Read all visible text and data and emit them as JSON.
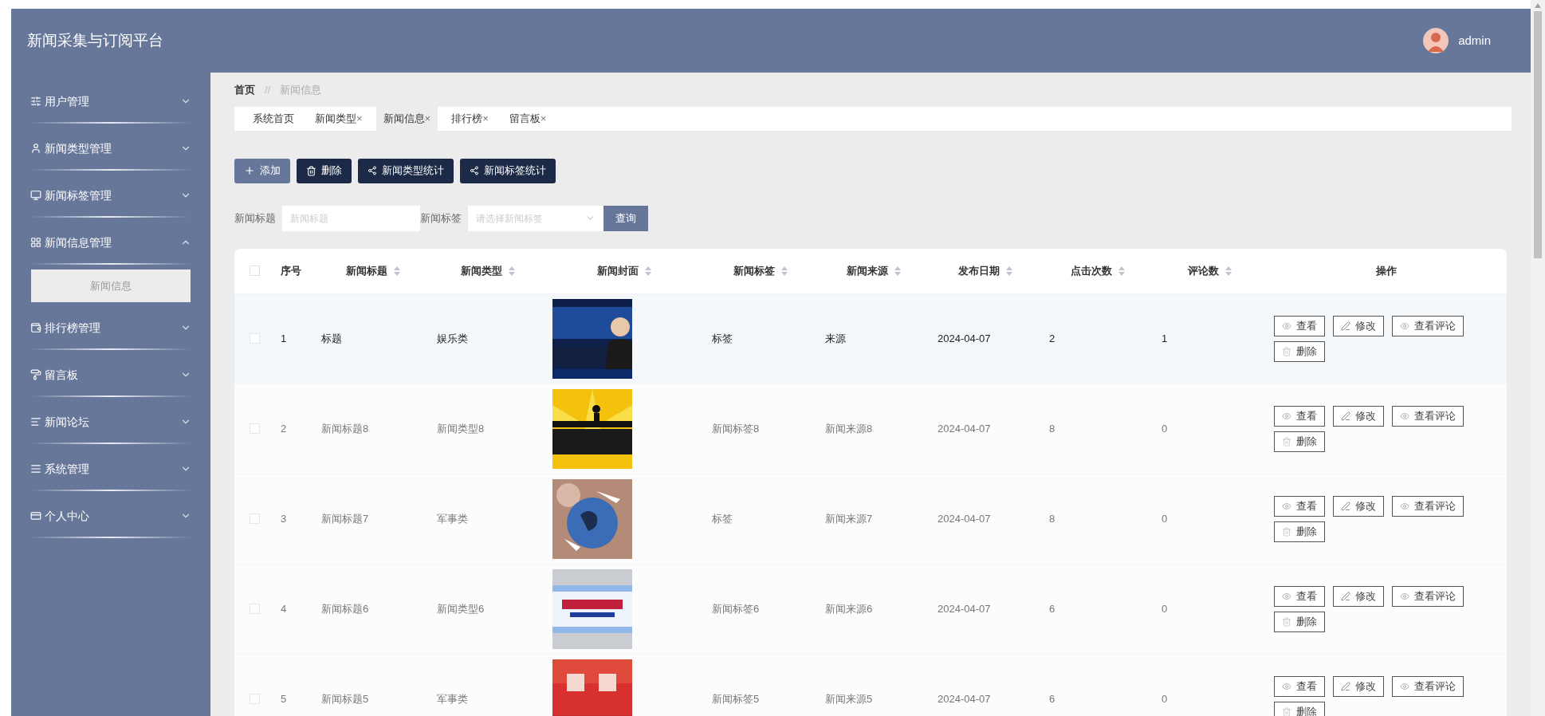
{
  "header": {
    "title": "新闻采集与订阅平台",
    "user": "admin"
  },
  "sidebar": {
    "items": [
      {
        "label": "用户管理",
        "expanded": false
      },
      {
        "label": "新闻类型管理",
        "expanded": false
      },
      {
        "label": "新闻标签管理",
        "expanded": false
      },
      {
        "label": "新闻信息管理",
        "expanded": true,
        "children": [
          {
            "label": "新闻信息",
            "selected": true
          }
        ]
      },
      {
        "label": "排行榜管理",
        "expanded": false
      },
      {
        "label": "留言板",
        "expanded": false
      },
      {
        "label": "新闻论坛",
        "expanded": false
      },
      {
        "label": "系统管理",
        "expanded": false
      },
      {
        "label": "个人中心",
        "expanded": false
      }
    ]
  },
  "breadcrumb": [
    {
      "label": "首页"
    },
    {
      "label": "新闻信息"
    }
  ],
  "breadcrumb_separator": "//",
  "tabs": [
    {
      "label": "系统首页",
      "selected": false
    },
    {
      "label": "新闻类型",
      "close": "×",
      "selected": false
    },
    {
      "label": "新闻信息",
      "close": "×",
      "selected": true
    },
    {
      "label": "排行榜",
      "close": "×",
      "selected": false
    },
    {
      "label": "留言板",
      "close": "×",
      "selected": false
    }
  ],
  "toolbar": [
    {
      "label": "添加",
      "kind": "add"
    },
    {
      "label": "删除",
      "kind": "delete"
    },
    {
      "label": "新闻类型统计",
      "kind": "stats"
    },
    {
      "label": "新闻标签统计",
      "kind": "stats"
    }
  ],
  "search": {
    "fields": [
      {
        "label": "新闻标题",
        "placeholder": "新闻标题",
        "kind": "text"
      },
      {
        "label": "新闻标签",
        "placeholder": "请选择新闻标签",
        "kind": "select"
      }
    ],
    "button": "查询"
  },
  "table": {
    "header_checked": false,
    "columns": [
      {
        "label": "序号",
        "sortable": false
      },
      {
        "label": "新闻标题",
        "sortable": true
      },
      {
        "label": "新闻类型",
        "sortable": true
      },
      {
        "label": "新闻封面",
        "sortable": true
      },
      {
        "label": "新闻标签",
        "sortable": true
      },
      {
        "label": "新闻来源",
        "sortable": true
      },
      {
        "label": "发布日期",
        "sortable": true
      },
      {
        "label": "点击次数",
        "sortable": true
      },
      {
        "label": "评论数",
        "sortable": true
      },
      {
        "label": "操作",
        "sortable": false
      }
    ],
    "rows": [
      {
        "checked": false,
        "hovered": true,
        "cells": [
          "1",
          "标题",
          "娱乐类"
        ],
        "cells2": [
          "标签",
          "来源",
          "2024-04-07",
          "2",
          "1"
        ],
        "actions": [
          {
            "label": "查看",
            "kind": "view"
          },
          {
            "label": "修改",
            "kind": "edit"
          },
          {
            "label": "查看评论",
            "kind": "view"
          },
          {
            "label": "删除",
            "kind": "delete"
          }
        ]
      },
      {
        "checked": false,
        "hovered": false,
        "cells": [
          "2",
          "新闻标题8",
          "新闻类型8"
        ],
        "cells2": [
          "新闻标签8",
          "新闻来源8",
          "2024-04-07",
          "8",
          "0"
        ],
        "actions": [
          {
            "label": "查看",
            "kind": "view"
          },
          {
            "label": "修改",
            "kind": "edit"
          },
          {
            "label": "查看评论",
            "kind": "view"
          },
          {
            "label": "删除",
            "kind": "delete"
          }
        ]
      },
      {
        "checked": false,
        "hovered": false,
        "cells": [
          "3",
          "新闻标题7",
          "军事类"
        ],
        "cells2": [
          "标签",
          "新闻来源7",
          "2024-04-07",
          "8",
          "0"
        ],
        "actions": [
          {
            "label": "查看",
            "kind": "view"
          },
          {
            "label": "修改",
            "kind": "edit"
          },
          {
            "label": "查看评论",
            "kind": "view"
          },
          {
            "label": "删除",
            "kind": "delete"
          }
        ]
      },
      {
        "checked": false,
        "hovered": false,
        "cells": [
          "4",
          "新闻标题6",
          "新闻类型6"
        ],
        "cells2": [
          "新闻标签6",
          "新闻来源6",
          "2024-04-07",
          "6",
          "0"
        ],
        "actions": [
          {
            "label": "查看",
            "kind": "view"
          },
          {
            "label": "修改",
            "kind": "edit"
          },
          {
            "label": "查看评论",
            "kind": "view"
          },
          {
            "label": "删除",
            "kind": "delete"
          }
        ]
      },
      {
        "checked": false,
        "hovered": false,
        "cells": [
          "5",
          "新闻标题5",
          "军事类"
        ],
        "cells2": [
          "新闻标签5",
          "新闻来源5",
          "2024-04-07",
          "6",
          "0"
        ],
        "actions": [
          {
            "label": "查看",
            "kind": "view"
          },
          {
            "label": "修改",
            "kind": "edit"
          },
          {
            "label": "查看评论",
            "kind": "view"
          },
          {
            "label": "删除",
            "kind": "delete"
          }
        ]
      }
    ]
  }
}
